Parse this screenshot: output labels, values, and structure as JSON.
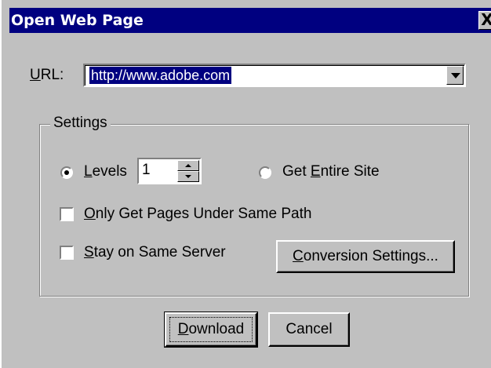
{
  "dialog": {
    "title": "Open Web Page",
    "close_glyph": "X",
    "url": {
      "label_accel": "U",
      "label_rest": "RL:",
      "value": "http://www.adobe.com"
    },
    "settings": {
      "group_title": "Settings",
      "levels": {
        "label_accel": "L",
        "label_rest": "evels",
        "selected": true,
        "value": "1"
      },
      "entire_site": {
        "label_pre": "Get ",
        "label_accel": "E",
        "label_rest": "ntire Site",
        "selected": false
      },
      "same_path": {
        "label_accel": "O",
        "label_rest": "nly Get Pages Under Same Path",
        "checked": false
      },
      "same_server": {
        "label_accel": "S",
        "label_rest": "tay on Same Server",
        "checked": false
      },
      "conversion_button": {
        "label_accel": "C",
        "label_rest": "onversion Settings..."
      }
    },
    "buttons": {
      "download": {
        "label_accel": "D",
        "label_rest": "ownload"
      },
      "cancel": {
        "label": "Cancel"
      }
    },
    "colors": {
      "face": "#c0c0c0",
      "titlebar": "#000080",
      "selection": "#000080"
    },
    "icons": {
      "close": "close-icon",
      "dropdown": "chevron-down-icon",
      "spin_up": "arrow-up-icon",
      "spin_down": "arrow-down-icon"
    }
  }
}
